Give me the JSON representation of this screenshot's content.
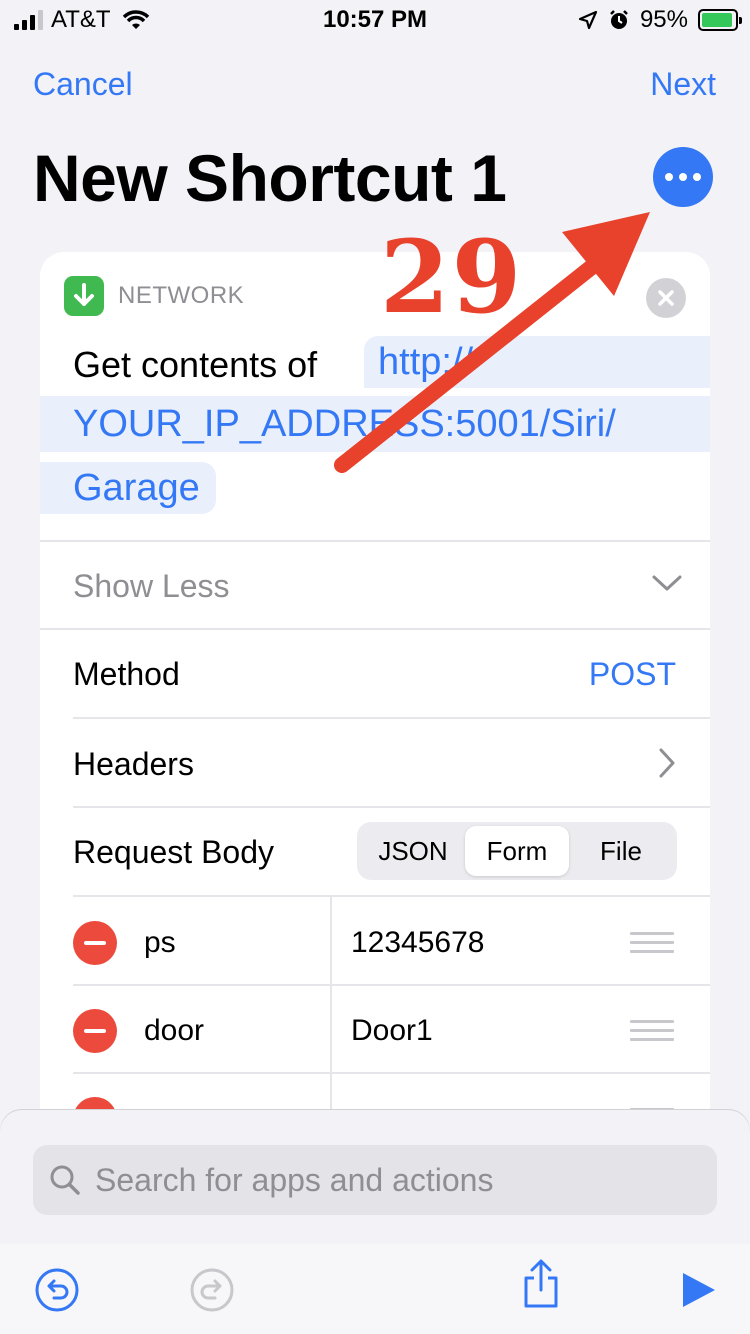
{
  "status_bar": {
    "carrier": "AT&T",
    "time": "10:57 PM",
    "battery_percent": "95%",
    "battery_level": 0.95,
    "signal_bars": 3,
    "icons": [
      "signal-icon",
      "wifi-icon",
      "location-icon",
      "alarm-icon",
      "battery-icon"
    ]
  },
  "nav": {
    "cancel_label": "Cancel",
    "next_label": "Next",
    "title": "New Shortcut 1",
    "more_icon": "ellipsis-icon"
  },
  "annotation": {
    "number": "29",
    "color": "#e8412c"
  },
  "action_card": {
    "category": "NETWORK",
    "category_icon": "download-arrow-icon",
    "action_prefix": "Get contents of",
    "url_parts": [
      "http://",
      "YOUR_IP_ADDRESS:5001/Siri/",
      "Garage"
    ],
    "show_less_label": "Show Less",
    "method_label": "Method",
    "method_value": "POST",
    "headers_label": "Headers",
    "request_body_label": "Request Body",
    "body_types": [
      "JSON",
      "Form",
      "File"
    ],
    "selected_body_type": "Form",
    "form_fields": [
      {
        "key": "ps",
        "value": "12345678"
      },
      {
        "key": "door",
        "value": "Door1"
      },
      {
        "key": "",
        "value": ""
      }
    ]
  },
  "bottom": {
    "search_placeholder": "Search for apps and actions",
    "toolbar_icons": [
      "undo-icon",
      "redo-icon",
      "share-icon",
      "play-icon"
    ]
  },
  "colors": {
    "accent": "#3478f6",
    "destructive": "#eb4a3c",
    "network_green": "#3fb950",
    "background": "#f2f2f7"
  }
}
